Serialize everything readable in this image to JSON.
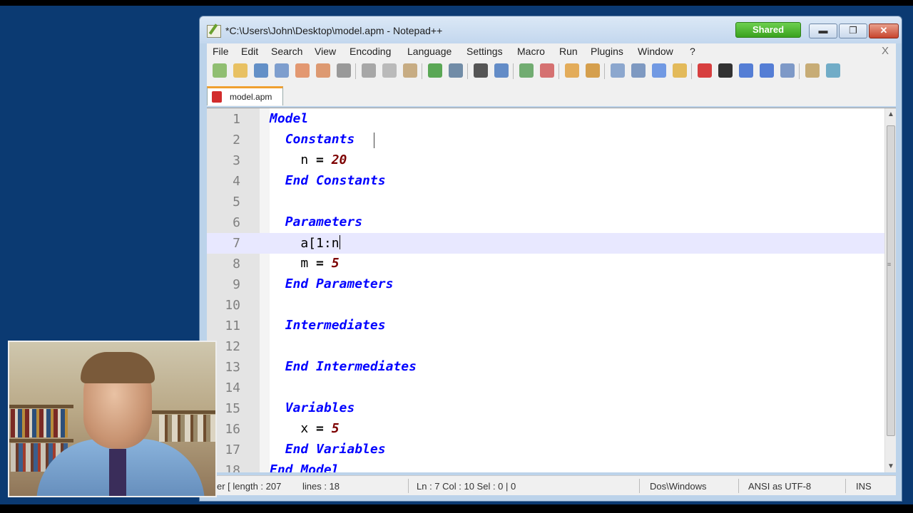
{
  "window": {
    "title": "*C:\\Users\\John\\Desktop\\model.apm - Notepad++",
    "shared_badge": "Shared",
    "minimize": "▬",
    "maximize": "❐",
    "close": "✕"
  },
  "menu": [
    "File",
    "Edit",
    "Search",
    "View",
    "Encoding",
    "Language",
    "Settings",
    "Macro",
    "Run",
    "Plugins",
    "Window",
    "?"
  ],
  "menu_close": "X",
  "tab": {
    "label": "model.apm"
  },
  "editor": {
    "lines": [
      {
        "n": "1",
        "segments": [
          {
            "t": "Model",
            "c": "kw"
          }
        ]
      },
      {
        "n": "2",
        "segments": [
          {
            "t": "  ",
            "c": "plain"
          },
          {
            "t": "Constants",
            "c": "kw"
          }
        ]
      },
      {
        "n": "3",
        "segments": [
          {
            "t": "    n ",
            "c": "plain"
          },
          {
            "t": "=",
            "c": "op"
          },
          {
            "t": " ",
            "c": "plain"
          },
          {
            "t": "20",
            "c": "num"
          }
        ]
      },
      {
        "n": "4",
        "segments": [
          {
            "t": "  ",
            "c": "plain"
          },
          {
            "t": "End Constants",
            "c": "kw"
          }
        ]
      },
      {
        "n": "5",
        "segments": []
      },
      {
        "n": "6",
        "segments": [
          {
            "t": "  ",
            "c": "plain"
          },
          {
            "t": "Parameters",
            "c": "kw"
          }
        ]
      },
      {
        "n": "7",
        "segments": [
          {
            "t": "    a[1:n",
            "c": "plain"
          }
        ],
        "current": true
      },
      {
        "n": "8",
        "segments": [
          {
            "t": "    m ",
            "c": "plain"
          },
          {
            "t": "=",
            "c": "op"
          },
          {
            "t": " ",
            "c": "plain"
          },
          {
            "t": "5",
            "c": "num"
          }
        ]
      },
      {
        "n": "9",
        "segments": [
          {
            "t": "  ",
            "c": "plain"
          },
          {
            "t": "End Parameters",
            "c": "kw"
          }
        ]
      },
      {
        "n": "10",
        "segments": []
      },
      {
        "n": "11",
        "segments": [
          {
            "t": "  ",
            "c": "plain"
          },
          {
            "t": "Intermediates",
            "c": "kw"
          }
        ]
      },
      {
        "n": "12",
        "segments": []
      },
      {
        "n": "13",
        "segments": [
          {
            "t": "  ",
            "c": "plain"
          },
          {
            "t": "End Intermediates",
            "c": "kw"
          }
        ]
      },
      {
        "n": "14",
        "segments": []
      },
      {
        "n": "15",
        "segments": [
          {
            "t": "  ",
            "c": "plain"
          },
          {
            "t": "Variables",
            "c": "kw"
          }
        ]
      },
      {
        "n": "16",
        "segments": [
          {
            "t": "    x ",
            "c": "plain"
          },
          {
            "t": "=",
            "c": "op"
          },
          {
            "t": " ",
            "c": "plain"
          },
          {
            "t": "5",
            "c": "num"
          }
        ]
      },
      {
        "n": "17",
        "segments": [
          {
            "t": "  ",
            "c": "plain"
          },
          {
            "t": "End Variables",
            "c": "kw"
          }
        ]
      },
      {
        "n": "18",
        "segments": [
          {
            "t": "End Model",
            "c": "kw"
          }
        ]
      }
    ]
  },
  "status": {
    "length": "er [ length : 207",
    "lines": "lines : 18",
    "position": "Ln : 7    Col : 10    Sel : 0 | 0",
    "eol": "Dos\\Windows",
    "encoding": "ANSI as UTF-8",
    "mode": "INS"
  },
  "toolbar_icons": [
    "new-file-icon",
    "open-file-icon",
    "save-icon",
    "save-all-icon",
    "close-icon",
    "close-all-icon",
    "print-icon",
    "cut-icon",
    "copy-icon",
    "paste-icon",
    "undo-icon",
    "redo-icon",
    "find-icon",
    "replace-icon",
    "zoom-in-icon",
    "zoom-out-icon",
    "sync-vertical-icon",
    "sync-horizontal-icon",
    "word-wrap-icon",
    "show-all-chars-icon",
    "indent-guide-icon",
    "user-lang-icon",
    "record-macro-icon",
    "stop-macro-icon",
    "play-macro-icon",
    "run-macro-multiple-icon",
    "save-macro-icon",
    "plugin-icon",
    "spellcheck-icon"
  ],
  "colors": {
    "keyword": "#0000ff",
    "number": "#7d0000",
    "current_line": "#e8e8ff",
    "desktop": "#0b3a72",
    "shared_badge": "#3aa21f"
  }
}
